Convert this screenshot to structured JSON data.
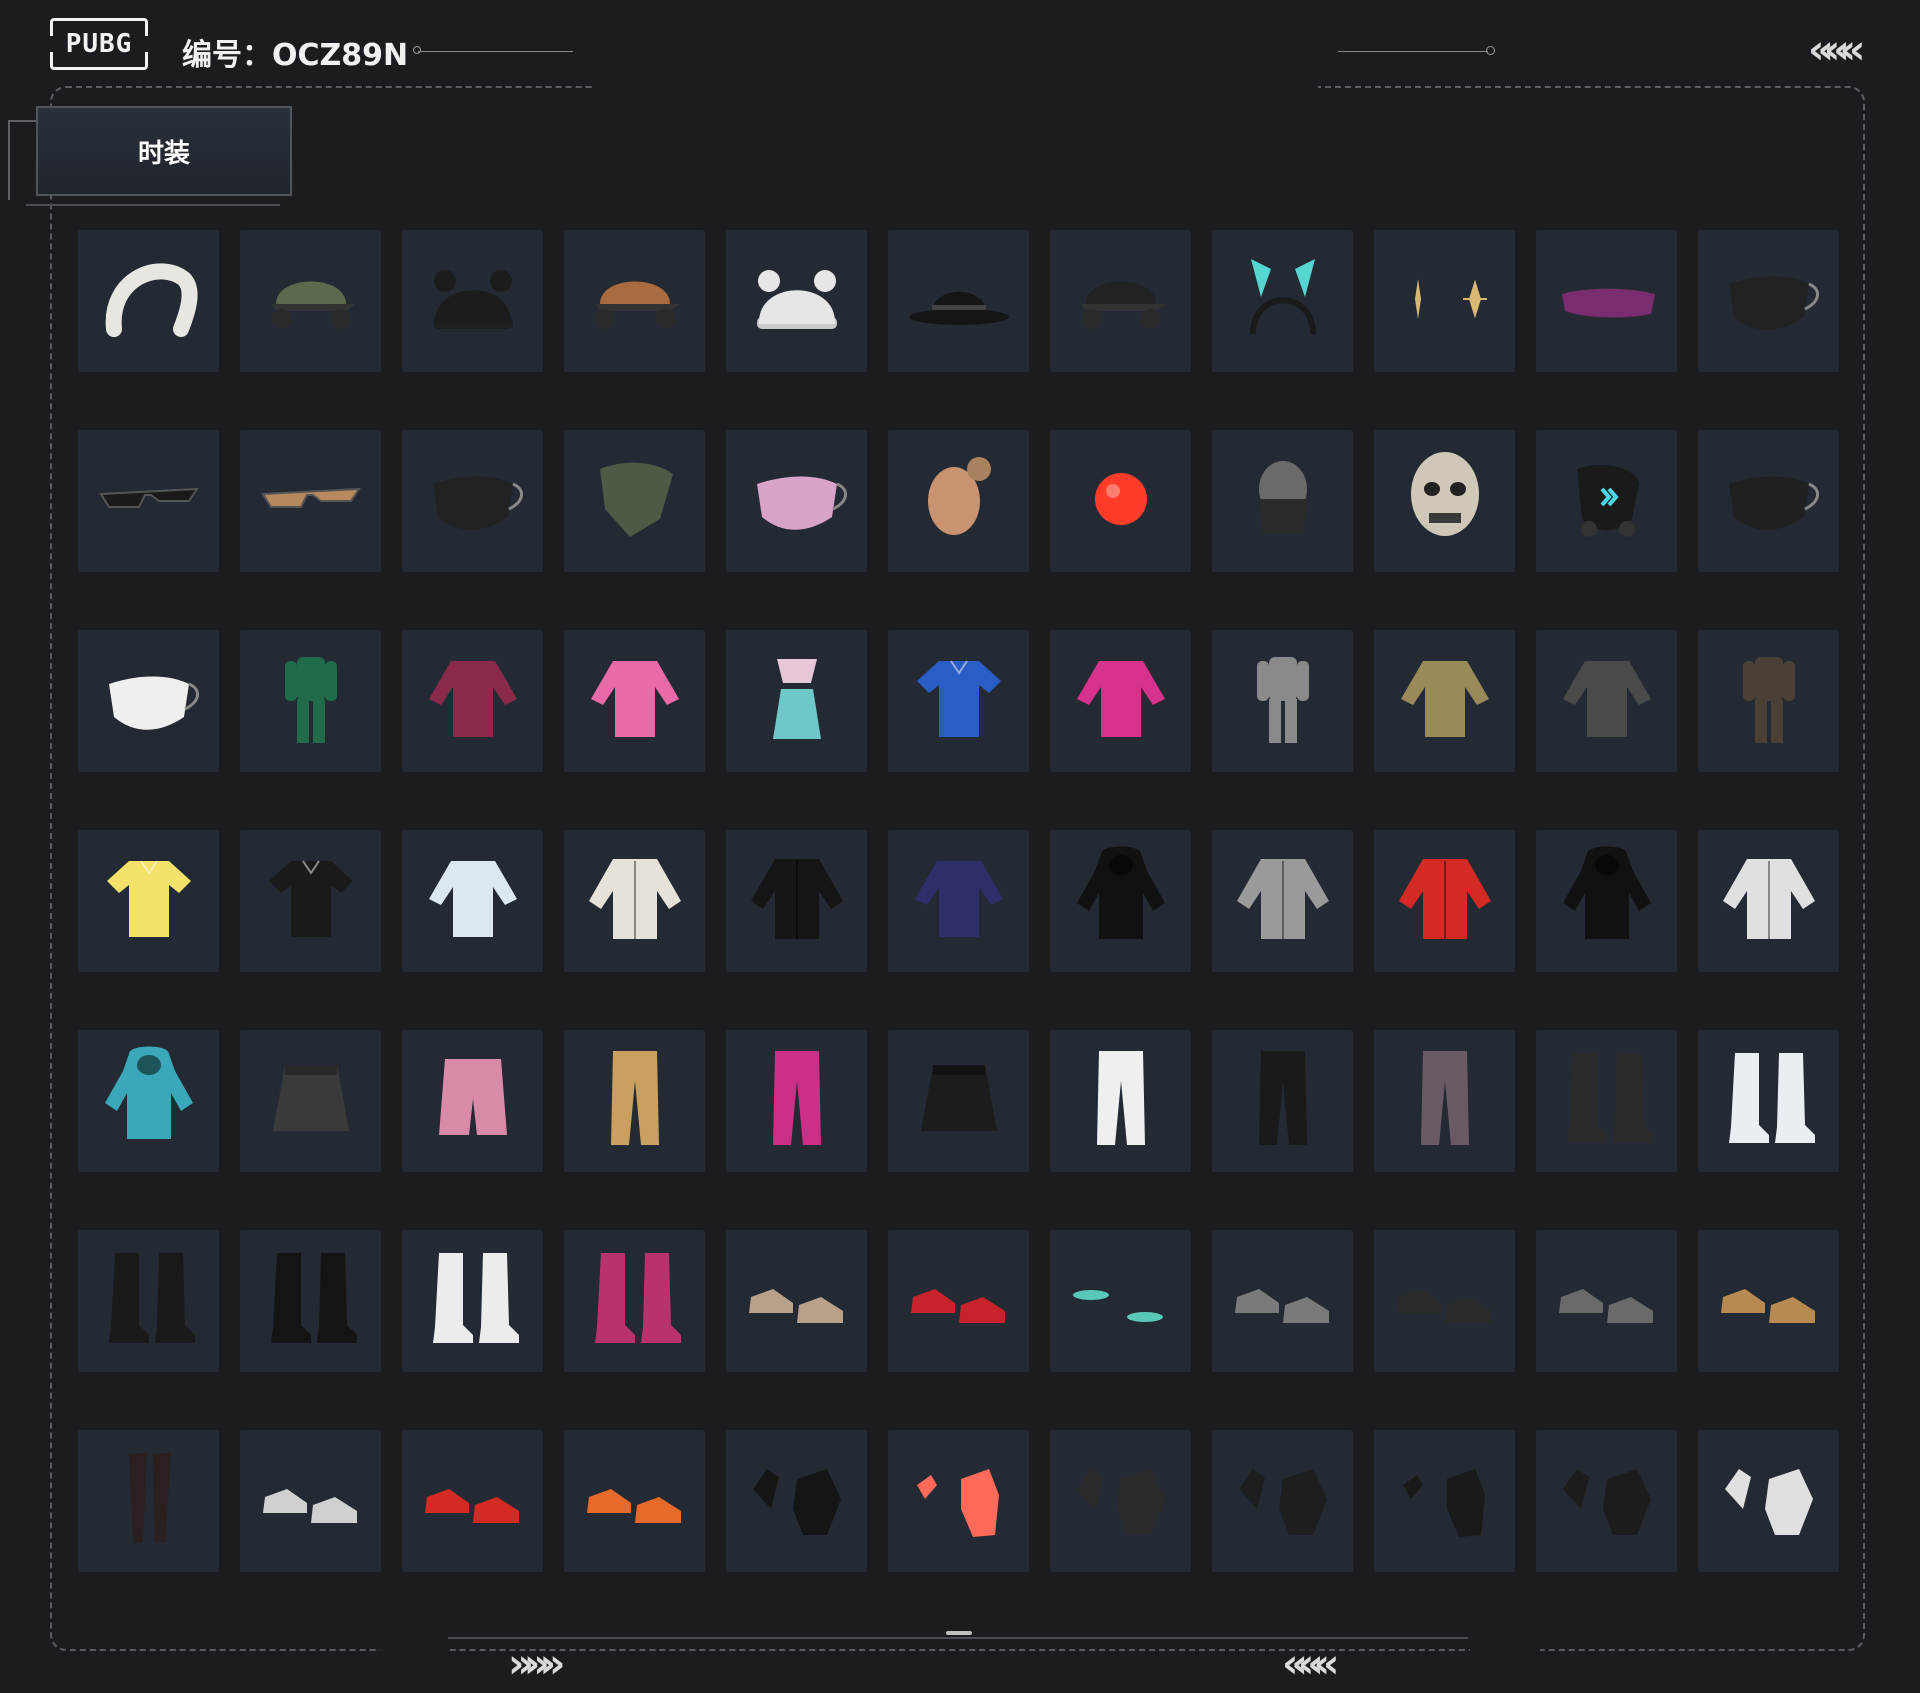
{
  "header": {
    "logo_text": "PUBG",
    "id_label": "编号：OCZ89N"
  },
  "tab": {
    "label": "时装"
  },
  "decor": {
    "chevron_left": "«««",
    "chevron_right": "»»»"
  },
  "items": [
    {
      "name": "white fur headband",
      "icon": "headband-icon",
      "color": "#e8e6e0"
    },
    {
      "name": "green headset cap",
      "icon": "cap-icon",
      "color": "#5b6a4d"
    },
    {
      "name": "black cat-ear beanie",
      "icon": "beanie-icon",
      "color": "#1c1c1c"
    },
    {
      "name": "brown headset cap",
      "icon": "cap-icon",
      "color": "#a86a3e"
    },
    {
      "name": "white bear beanie",
      "icon": "beanie-icon",
      "color": "#e6e6e6"
    },
    {
      "name": "black fedora",
      "icon": "hat-icon",
      "color": "#151515"
    },
    {
      "name": "black baseball cap",
      "icon": "cap-icon",
      "color": "#222222"
    },
    {
      "name": "bunny ear headband",
      "icon": "ears-icon",
      "color": "#55d6d0"
    },
    {
      "name": "gold star earrings",
      "icon": "star-icon",
      "color": "#d9b873"
    },
    {
      "name": "purple visor",
      "icon": "visor-icon",
      "color": "#7a2d6e"
    },
    {
      "name": "cat face mask",
      "icon": "mask-icon",
      "color": "#222222"
    },
    {
      "name": "black sunglasses",
      "icon": "glasses-icon",
      "color": "#1a1a1a"
    },
    {
      "name": "tan sunglasses",
      "icon": "glasses-icon",
      "color": "#b68a5c"
    },
    {
      "name": "black face mask",
      "icon": "mask-icon",
      "color": "#222222"
    },
    {
      "name": "camo neck gaiter",
      "icon": "gaiter-icon",
      "color": "#4e5a45"
    },
    {
      "name": "pink teeth mask",
      "icon": "mask-icon",
      "color": "#d9a2c8"
    },
    {
      "name": "bald head mask",
      "icon": "head-icon",
      "color": "#c99270"
    },
    {
      "name": "red clown nose",
      "icon": "nose-icon",
      "color": "#ff3b2a"
    },
    {
      "name": "tactical balaclava",
      "icon": "balaclava-icon",
      "color": "#2a2a2a"
    },
    {
      "name": "mummy skull mask",
      "icon": "skull-icon",
      "color": "#cfc7b8"
    },
    {
      "name": "cyber gas mask",
      "icon": "gasmask-icon",
      "color": "#1a1a1a"
    },
    {
      "name": "shark teeth mask",
      "icon": "mask-icon",
      "color": "#202020"
    },
    {
      "name": "white x mask",
      "icon": "mask-icon",
      "color": "#efefef"
    },
    {
      "name": "green racing suit",
      "icon": "suit-icon",
      "color": "#1f6b4a"
    },
    {
      "name": "striped hoodie",
      "icon": "top-icon",
      "color": "#8a2a4a"
    },
    {
      "name": "pink crop sweater",
      "icon": "top-icon",
      "color": "#e86aa8"
    },
    {
      "name": "pink mermaid outfit",
      "icon": "dress-icon",
      "color": "#6fc8c8"
    },
    {
      "name": "blue polo shirt",
      "icon": "shirt-icon",
      "color": "#2a5dc6"
    },
    {
      "name": "pink long sleeve",
      "icon": "top-icon",
      "color": "#d8338c"
    },
    {
      "name": "grey suit",
      "icon": "suit-icon",
      "color": "#8a8a8a"
    },
    {
      "name": "tan crop top",
      "icon": "top-icon",
      "color": "#9a8a5a"
    },
    {
      "name": "metal corset",
      "icon": "top-icon",
      "color": "#4a4a4a"
    },
    {
      "name": "brown outfit",
      "icon": "suit-icon",
      "color": "#4a4036"
    },
    {
      "name": "pikachu tee",
      "icon": "shirt-icon",
      "color": "#f5e26a"
    },
    {
      "name": "black shirt tie",
      "icon": "shirt-icon",
      "color": "#1a1a1a"
    },
    {
      "name": "bunny fluffy hoodie",
      "icon": "top-icon",
      "color": "#dce8f0"
    },
    {
      "name": "white fur jacket",
      "icon": "jacket-icon",
      "color": "#e6e2d8"
    },
    {
      "name": "black leather jacket",
      "icon": "jacket-icon",
      "color": "#151515"
    },
    {
      "name": "navy sweater",
      "icon": "top-icon",
      "color": "#2d2f6a"
    },
    {
      "name": "black hooded cloak",
      "icon": "hood-icon",
      "color": "#111111"
    },
    {
      "name": "silver jacket",
      "icon": "jacket-icon",
      "color": "#9a9a9a"
    },
    {
      "name": "red varsity jacket",
      "icon": "jacket-icon",
      "color": "#d42a24"
    },
    {
      "name": "black hoodie aura",
      "icon": "hood-icon",
      "color": "#111111"
    },
    {
      "name": "white tech jacket",
      "icon": "jacket-icon",
      "color": "#e0e0e0"
    },
    {
      "name": "gradient bunny hoodie",
      "icon": "hood-icon",
      "color": "#3aa8b8"
    },
    {
      "name": "plaid skirt",
      "icon": "skirt-icon",
      "color": "#3a3a3a"
    },
    {
      "name": "pink plaid shorts",
      "icon": "shorts-icon",
      "color": "#d98aa8"
    },
    {
      "name": "tan trousers",
      "icon": "pants-icon",
      "color": "#c9a060"
    },
    {
      "name": "pink leggings",
      "icon": "pants-icon",
      "color": "#cc2f86"
    },
    {
      "name": "black skirt",
      "icon": "skirt-icon",
      "color": "#1c1c1c"
    },
    {
      "name": "white pants",
      "icon": "pants-icon",
      "color": "#efefef"
    },
    {
      "name": "black joggers",
      "icon": "pants-icon",
      "color": "#1a1a1a"
    },
    {
      "name": "camo pants",
      "icon": "pants-icon",
      "color": "#6a5a66"
    },
    {
      "name": "black fur boots",
      "icon": "boots-icon",
      "color": "#2a2a2a"
    },
    {
      "name": "white fur leg warmers",
      "icon": "boots-icon",
      "color": "#e8eef2"
    },
    {
      "name": "racing boots",
      "icon": "boots-icon",
      "color": "#1a1a1a"
    },
    {
      "name": "black tall boots",
      "icon": "boots-icon",
      "color": "#141414"
    },
    {
      "name": "white fluffy boots",
      "icon": "boots-icon",
      "color": "#ececec"
    },
    {
      "name": "pink striped boots",
      "icon": "boots-icon",
      "color": "#b8336e"
    },
    {
      "name": "bunny sneakers",
      "icon": "shoes-icon",
      "color": "#b8a08a"
    },
    {
      "name": "red sneakers",
      "icon": "shoes-icon",
      "color": "#c8232b"
    },
    {
      "name": "teal flip flops",
      "icon": "sandals-icon",
      "color": "#5ac8b8"
    },
    {
      "name": "grey high tops",
      "icon": "shoes-icon",
      "color": "#7a7a7a"
    },
    {
      "name": "black hiking shoes",
      "icon": "shoes-icon",
      "color": "#2a2a2a"
    },
    {
      "name": "grey chelsea boots",
      "icon": "shoes-icon",
      "color": "#6a6a6a"
    },
    {
      "name": "tan clogs",
      "icon": "shoes-icon",
      "color": "#b88a52"
    },
    {
      "name": "thigh high stockings",
      "icon": "legs-icon",
      "color": "#2a2020"
    },
    {
      "name": "white sneakers",
      "icon": "shoes-icon",
      "color": "#d0d0d0"
    },
    {
      "name": "red high tops",
      "icon": "shoes-icon",
      "color": "#d42a24"
    },
    {
      "name": "orange sneakers",
      "icon": "shoes-icon",
      "color": "#e86a2a"
    },
    {
      "name": "black gloves gold",
      "icon": "gloves-icon",
      "color": "#151515"
    },
    {
      "name": "red hands",
      "icon": "hand-icon",
      "color": "#ff6a5a"
    },
    {
      "name": "tactical gloves",
      "icon": "gloves-icon",
      "color": "#2a2a2a"
    },
    {
      "name": "black knuckle gloves",
      "icon": "gloves-icon",
      "color": "#1e1e1e"
    },
    {
      "name": "black long claws",
      "icon": "hand-icon",
      "color": "#1a1a1a"
    },
    {
      "name": "fingerless gloves",
      "icon": "gloves-icon",
      "color": "#1c1c1c"
    },
    {
      "name": "white green gloves",
      "icon": "gloves-icon",
      "color": "#e0e0e0"
    }
  ]
}
